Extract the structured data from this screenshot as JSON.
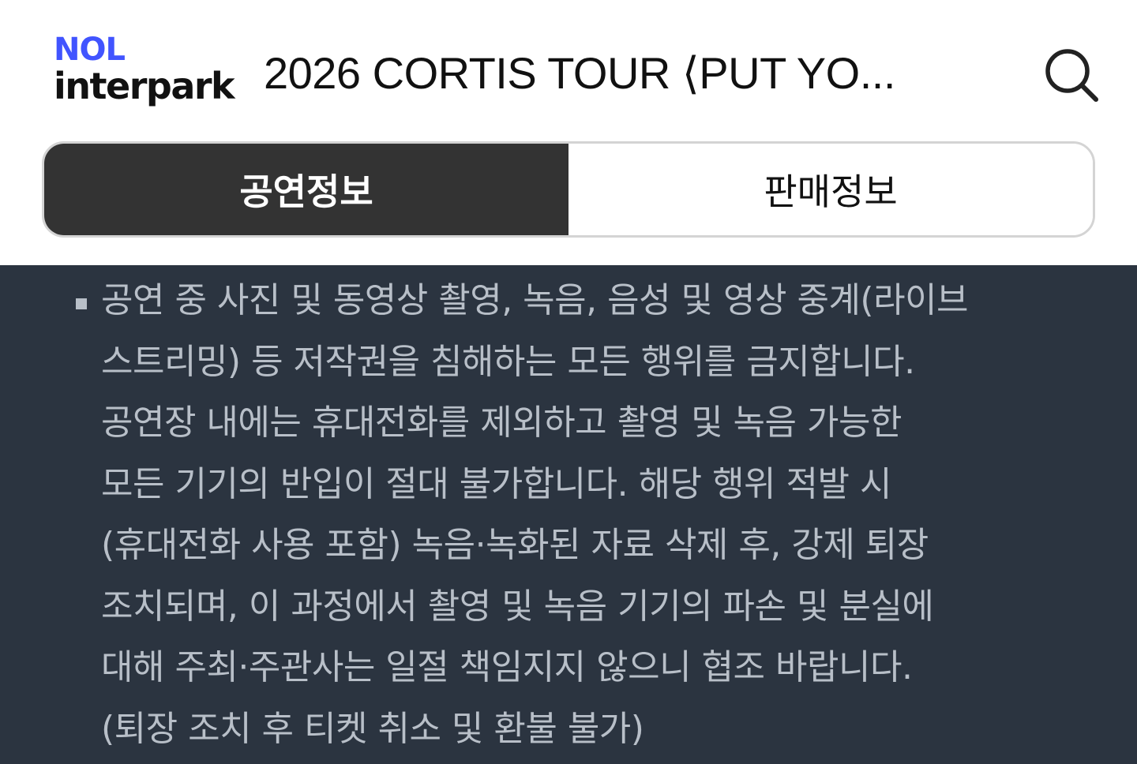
{
  "header": {
    "logo_top": "NOL",
    "logo_bottom": "interpark",
    "title": "2026 CORTIS TOUR ⟨PUT YO...",
    "search_icon": "search-icon"
  },
  "tabs": [
    {
      "label": "공연정보",
      "active": true
    },
    {
      "label": "판매정보",
      "active": false
    }
  ],
  "notice": {
    "lines": [
      "공연 중 사진 및 동영상 촬영, 녹음, 음성 및 영상 중계(라이브",
      "스트리밍) 등 저작권을 침해하는 모든 행위를 금지합니다.",
      "공연장 내에는 휴대전화를 제외하고 촬영 및 녹음 가능한",
      "모든 기기의 반입이 절대 불가합니다. 해당 행위 적발 시",
      "(휴대전화 사용 포함) 녹음·녹화된 자료 삭제 후, 강제 퇴장",
      "조치되며, 이 과정에서 촬영 및 녹음 기기의 파손 및 분실에",
      "대해 주최·주관사는 일절 책임지지 않으니 협조 바랍니다.",
      "(퇴장 조치 후 티켓 취소 및 환불 불가)"
    ]
  },
  "colors": {
    "brand_blue": "#4154ff",
    "active_tab_bg": "#333333",
    "content_bg": "#2b3440",
    "notice_text": "#b8bfc8"
  }
}
